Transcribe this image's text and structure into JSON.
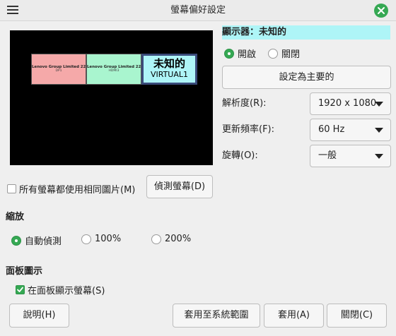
{
  "window": {
    "title": "螢幕偏好設定"
  },
  "colors": {
    "accent": "#35a853",
    "selected_header": "#aef5f7",
    "monitor_1": "#f5a9a9",
    "monitor_2": "#a9f5cf",
    "monitor_active": "#aef5f7"
  },
  "preview": {
    "monitors": [
      {
        "name": "Lenovo Group Limited 22\"",
        "port": "DP1"
      },
      {
        "name": "Lenovo Group Limited 22\"",
        "port": "HDMI3"
      },
      {
        "title": "未知的",
        "subtitle": "VIRTUAL1"
      }
    ]
  },
  "display": {
    "header": "顯示器：未知的",
    "power_on": "開啟",
    "power_off": "關閉",
    "set_primary": "設定為主要的",
    "resolution_label": "解析度(R):",
    "resolution_value": "1920 x 1080",
    "refresh_label": "更新頻率(F):",
    "refresh_value": "60 Hz",
    "rotation_label": "旋轉(O):",
    "rotation_value": "一般"
  },
  "same_image_label": "所有螢幕都使用相同圖片(M)",
  "detect_button": "偵測螢幕(D)",
  "scale": {
    "title": "縮放",
    "auto": "自動偵測",
    "p100": "100%",
    "p200": "200%"
  },
  "panel": {
    "title": "面板圖示",
    "show_label": "在面板顯示螢幕(S)"
  },
  "footer": {
    "help": "說明(H)",
    "apply_system": "套用至系統範圍",
    "apply": "套用(A)",
    "close": "關閉(C)"
  }
}
